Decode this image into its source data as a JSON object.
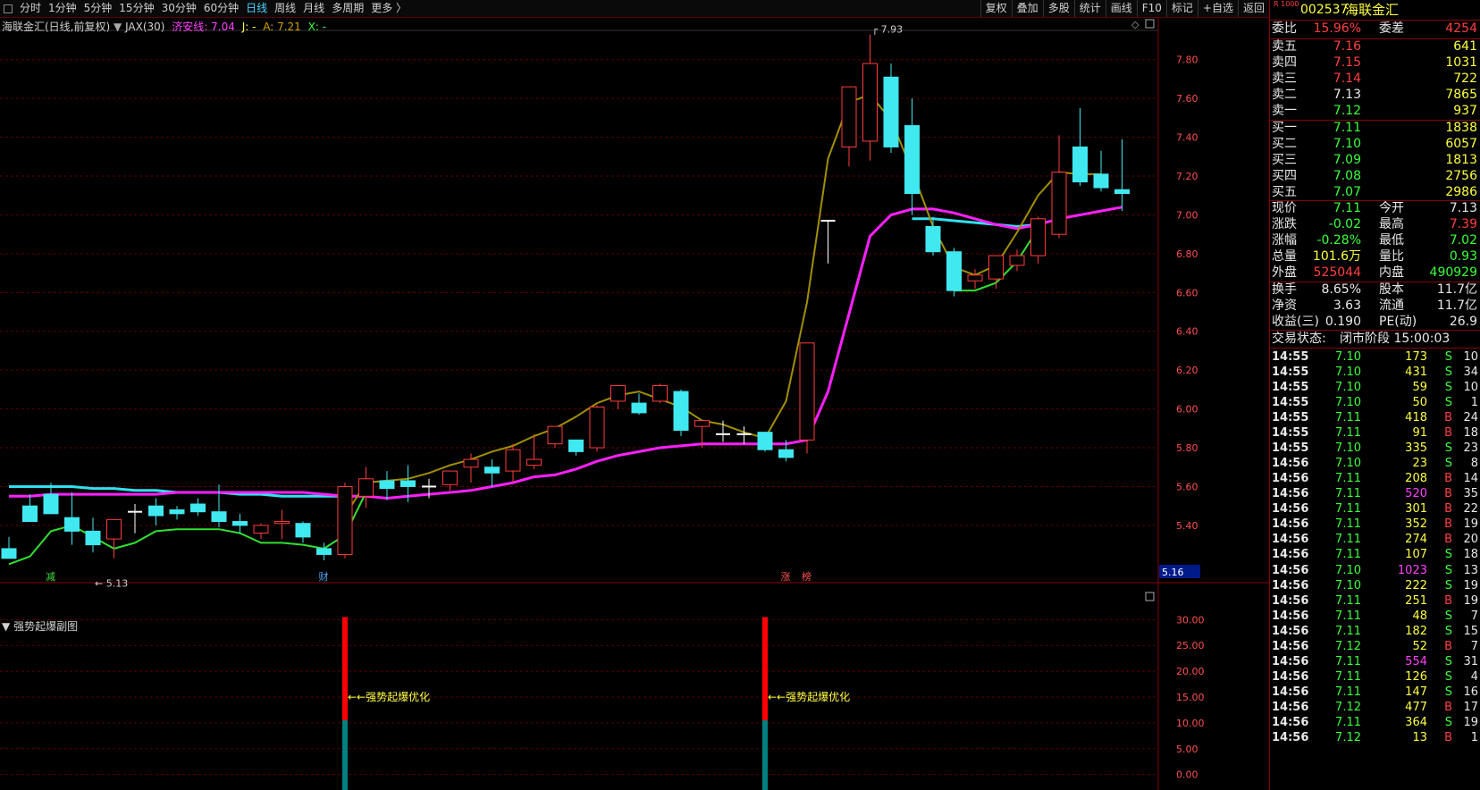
{
  "toolbar": {
    "periods": [
      "分时",
      "1分钟",
      "5分钟",
      "15分钟",
      "30分钟",
      "60分钟",
      "日线",
      "周线",
      "月线",
      "多周期",
      "更多 〉"
    ],
    "active": "日线",
    "right": [
      "复权",
      "叠加",
      "多股",
      "统计",
      "画线",
      "F10",
      "标记",
      "+自选",
      "返回"
    ]
  },
  "legend": {
    "title": "海联金汇(日线,前复权)",
    "indicator": "JAX(30)",
    "items": [
      {
        "text": "济安线: 7.04",
        "color": "#ff40ff"
      },
      {
        "text": "J: -",
        "color": "#ffff40"
      },
      {
        "text": "A: 7.21",
        "color": "#d0a000"
      },
      {
        "text": "X: -",
        "color": "#3cff3c"
      }
    ]
  },
  "chart_data": {
    "type": "candlestick",
    "y_ticks": [
      "7.80",
      "7.60",
      "7.40",
      "7.20",
      "7.00",
      "6.80",
      "6.60",
      "6.40",
      "6.20",
      "6.00",
      "5.80",
      "5.60",
      "5.40"
    ],
    "ylim": [
      5.16,
      7.96
    ],
    "current_price_tag": "5.16",
    "high_annotation": "7.93",
    "low_annotation": "5.13",
    "event_markers": [
      {
        "text": "减",
        "at": 2
      },
      {
        "text": "财",
        "at": 15
      },
      {
        "text": "涨",
        "at": 37
      },
      {
        "text": "榜",
        "at": 38
      }
    ],
    "candles": [
      {
        "o": 5.28,
        "h": 5.34,
        "l": 5.23,
        "c": 5.23
      },
      {
        "o": 5.5,
        "h": 5.56,
        "l": 5.44,
        "c": 5.42
      },
      {
        "o": 5.56,
        "h": 5.62,
        "l": 5.51,
        "c": 5.46
      },
      {
        "o": 5.44,
        "h": 5.57,
        "l": 5.3,
        "c": 5.37
      },
      {
        "o": 5.37,
        "h": 5.44,
        "l": 5.26,
        "c": 5.3
      },
      {
        "o": 5.33,
        "h": 5.42,
        "l": 5.23,
        "c": 5.43
      },
      {
        "o": 5.47,
        "h": 5.51,
        "l": 5.36,
        "c": 5.47
      },
      {
        "o": 5.5,
        "h": 5.54,
        "l": 5.4,
        "c": 5.45
      },
      {
        "o": 5.48,
        "h": 5.5,
        "l": 5.43,
        "c": 5.46
      },
      {
        "o": 5.51,
        "h": 5.54,
        "l": 5.45,
        "c": 5.47
      },
      {
        "o": 5.47,
        "h": 5.61,
        "l": 5.39,
        "c": 5.42
      },
      {
        "o": 5.42,
        "h": 5.46,
        "l": 5.36,
        "c": 5.4
      },
      {
        "o": 5.36,
        "h": 5.41,
        "l": 5.33,
        "c": 5.4
      },
      {
        "o": 5.41,
        "h": 5.48,
        "l": 5.33,
        "c": 5.42
      },
      {
        "o": 5.41,
        "h": 5.42,
        "l": 5.31,
        "c": 5.34
      },
      {
        "o": 5.28,
        "h": 5.31,
        "l": 5.22,
        "c": 5.25
      },
      {
        "o": 5.25,
        "h": 5.62,
        "l": 5.23,
        "c": 5.6
      },
      {
        "o": 5.55,
        "h": 5.7,
        "l": 5.49,
        "c": 5.64
      },
      {
        "o": 5.63,
        "h": 5.68,
        "l": 5.53,
        "c": 5.59
      },
      {
        "o": 5.63,
        "h": 5.71,
        "l": 5.52,
        "c": 5.6
      },
      {
        "o": 5.6,
        "h": 5.64,
        "l": 5.54,
        "c": 5.6
      },
      {
        "o": 5.61,
        "h": 5.68,
        "l": 5.58,
        "c": 5.68
      },
      {
        "o": 5.7,
        "h": 5.77,
        "l": 5.62,
        "c": 5.74
      },
      {
        "o": 5.7,
        "h": 5.74,
        "l": 5.6,
        "c": 5.67
      },
      {
        "o": 5.68,
        "h": 5.82,
        "l": 5.62,
        "c": 5.79
      },
      {
        "o": 5.71,
        "h": 5.87,
        "l": 5.69,
        "c": 5.74
      },
      {
        "o": 5.82,
        "h": 5.91,
        "l": 5.8,
        "c": 5.91
      },
      {
        "o": 5.84,
        "h": 5.81,
        "l": 5.76,
        "c": 5.78
      },
      {
        "o": 5.8,
        "h": 6.02,
        "l": 5.78,
        "c": 6.01
      },
      {
        "o": 6.04,
        "h": 6.12,
        "l": 6.0,
        "c": 6.12
      },
      {
        "o": 6.03,
        "h": 6.08,
        "l": 5.97,
        "c": 5.98
      },
      {
        "o": 6.04,
        "h": 6.13,
        "l": 6.03,
        "c": 6.12
      },
      {
        "o": 6.09,
        "h": 6.1,
        "l": 5.86,
        "c": 5.89
      },
      {
        "o": 5.91,
        "h": 5.94,
        "l": 5.8,
        "c": 5.94
      },
      {
        "o": 5.87,
        "h": 5.94,
        "l": 5.83,
        "c": 5.87
      },
      {
        "o": 5.87,
        "h": 5.91,
        "l": 5.82,
        "c": 5.87
      },
      {
        "o": 5.88,
        "h": 5.84,
        "l": 5.78,
        "c": 5.79
      },
      {
        "o": 5.79,
        "h": 5.84,
        "l": 5.73,
        "c": 5.75
      },
      {
        "o": 5.84,
        "h": 6.34,
        "l": 5.77,
        "c": 6.34
      },
      {
        "o": 6.97,
        "h": 6.97,
        "l": 6.75,
        "c": 6.97
      },
      {
        "o": 7.35,
        "h": 7.66,
        "l": 7.25,
        "c": 7.66
      },
      {
        "o": 7.38,
        "h": 7.93,
        "l": 7.28,
        "c": 7.78
      },
      {
        "o": 7.71,
        "h": 7.78,
        "l": 7.32,
        "c": 7.35
      },
      {
        "o": 7.46,
        "h": 7.6,
        "l": 7.0,
        "c": 7.11
      },
      {
        "o": 6.94,
        "h": 6.99,
        "l": 6.79,
        "c": 6.81
      },
      {
        "o": 6.81,
        "h": 6.83,
        "l": 6.58,
        "c": 6.61
      },
      {
        "o": 6.66,
        "h": 6.72,
        "l": 6.62,
        "c": 6.69
      },
      {
        "o": 6.67,
        "h": 6.79,
        "l": 6.62,
        "c": 6.79
      },
      {
        "o": 6.74,
        "h": 6.82,
        "l": 6.71,
        "c": 6.79
      },
      {
        "o": 6.79,
        "h": 6.99,
        "l": 6.75,
        "c": 6.98
      },
      {
        "o": 6.9,
        "h": 7.41,
        "l": 6.88,
        "c": 7.22
      },
      {
        "o": 7.35,
        "h": 7.55,
        "l": 7.15,
        "c": 7.17
      },
      {
        "o": 7.21,
        "h": 7.33,
        "l": 7.12,
        "c": 7.14
      },
      {
        "o": 7.13,
        "h": 7.39,
        "l": 7.02,
        "c": 7.11
      }
    ],
    "line_magenta": [
      5.55,
      5.55,
      5.56,
      5.56,
      5.56,
      5.56,
      5.56,
      5.56,
      5.57,
      5.57,
      5.57,
      5.57,
      5.57,
      5.57,
      5.57,
      5.56,
      5.55,
      5.55,
      5.54,
      5.55,
      5.56,
      5.57,
      5.58,
      5.6,
      5.62,
      5.65,
      5.66,
      5.69,
      5.73,
      5.76,
      5.78,
      5.8,
      5.81,
      5.82,
      5.82,
      5.82,
      5.82,
      5.82,
      5.84,
      6.09,
      6.49,
      6.89,
      7.0,
      7.03,
      7.03,
      7.01,
      6.98,
      6.95,
      6.93,
      6.95,
      6.98,
      7.0,
      7.02,
      7.04
    ],
    "line_cyan": [
      5.6,
      5.6,
      5.6,
      5.6,
      5.59,
      5.59,
      5.58,
      5.58,
      5.57,
      5.57,
      5.57,
      5.56,
      5.56,
      5.55,
      5.55,
      5.55,
      5.55,
      null,
      null,
      null,
      null,
      null,
      null,
      null,
      null,
      null,
      null,
      null,
      null,
      null,
      null,
      null,
      null,
      null,
      null,
      null,
      null,
      null,
      null,
      null,
      null,
      null,
      null,
      6.98,
      6.98,
      6.97,
      6.96,
      6.95,
      6.94,
      6.95,
      null,
      null,
      null,
      null
    ],
    "line_olive": [
      null,
      null,
      null,
      null,
      null,
      null,
      null,
      null,
      null,
      null,
      null,
      null,
      null,
      null,
      null,
      null,
      5.45,
      5.62,
      5.63,
      5.64,
      5.67,
      5.71,
      5.74,
      5.78,
      5.81,
      5.86,
      5.9,
      5.96,
      6.03,
      6.07,
      6.09,
      6.05,
      6.01,
      5.94,
      5.92,
      5.88,
      5.85,
      6.04,
      6.55,
      7.29,
      7.58,
      7.62,
      7.49,
      7.23,
      6.94,
      6.73,
      6.69,
      6.74,
      6.91,
      7.1,
      7.22,
      7.21,
      7.21
    ],
    "line_green": [
      5.2,
      5.24,
      5.37,
      5.4,
      5.34,
      5.28,
      5.31,
      5.37,
      5.38,
      5.38,
      5.38,
      5.36,
      5.31,
      5.31,
      5.3,
      5.28,
      5.35,
      5.57,
      null,
      null,
      null,
      null,
      null,
      null,
      null,
      null,
      null,
      null,
      null,
      null,
      null,
      null,
      null,
      null,
      null,
      null,
      null,
      null,
      null,
      null,
      null,
      null,
      null,
      null,
      null,
      6.61,
      6.61,
      6.65,
      6.76,
      6.93,
      null,
      null,
      null,
      null
    ],
    "sub_chart": {
      "title": "强势起爆副图",
      "y_ticks": [
        "30.00",
        "25.00",
        "20.00",
        "15.00",
        "10.00",
        "5.00",
        "0.00"
      ],
      "ylim": [
        -3,
        33
      ],
      "signals": [
        {
          "at": 16,
          "label": "←←强势起爆优化",
          "value": 30.5,
          "split": 10.5
        },
        {
          "at": 36,
          "label": "←←强势起爆优化",
          "value": 30.5,
          "split": 10.5
        }
      ]
    }
  },
  "panel": {
    "code_prefix": "R 1000",
    "code": "002537",
    "name": "海联金汇",
    "weibi_label": "委比",
    "weibi": "15.96%",
    "weicha_label": "委差",
    "weicha": "4254",
    "asks": [
      {
        "label": "卖五",
        "price": "7.16",
        "vol": "641",
        "pc": "red"
      },
      {
        "label": "卖四",
        "price": "7.15",
        "vol": "1031",
        "pc": "red"
      },
      {
        "label": "卖三",
        "price": "7.14",
        "vol": "722",
        "pc": "red"
      },
      {
        "label": "卖二",
        "price": "7.13",
        "vol": "7865",
        "pc": "wht"
      },
      {
        "label": "卖一",
        "price": "7.12",
        "vol": "937",
        "pc": "grn"
      }
    ],
    "bids": [
      {
        "label": "买一",
        "price": "7.11",
        "vol": "1838",
        "pc": "grn"
      },
      {
        "label": "买二",
        "price": "7.10",
        "vol": "6057",
        "pc": "grn"
      },
      {
        "label": "买三",
        "price": "7.09",
        "vol": "1813",
        "pc": "grn"
      },
      {
        "label": "买四",
        "price": "7.08",
        "vol": "2756",
        "pc": "grn"
      },
      {
        "label": "买五",
        "price": "7.07",
        "vol": "2986",
        "pc": "grn"
      }
    ],
    "quote": [
      {
        "l1": "现价",
        "v1": "7.11",
        "c1": "grn",
        "l2": "今开",
        "v2": "7.13",
        "c2": "wht"
      },
      {
        "l1": "涨跌",
        "v1": "-0.02",
        "c1": "grn",
        "l2": "最高",
        "v2": "7.39",
        "c2": "red"
      },
      {
        "l1": "涨幅",
        "v1": "-0.28%",
        "c1": "grn",
        "l2": "最低",
        "v2": "7.02",
        "c2": "grn"
      },
      {
        "l1": "总量",
        "v1": "101.6万",
        "c1": "yel",
        "l2": "量比",
        "v2": "0.93",
        "c2": "grn"
      },
      {
        "l1": "外盘",
        "v1": "525044",
        "c1": "red",
        "l2": "内盘",
        "v2": "490929",
        "c2": "grn"
      }
    ],
    "fundamentals": [
      {
        "l1": "换手",
        "v1": "8.65%",
        "l2": "股本",
        "v2": "11.7亿"
      },
      {
        "l1": "净资",
        "v1": "3.63",
        "l2": "流通",
        "v2": "11.7亿"
      },
      {
        "l1": "收益(三)",
        "v1": "0.190",
        "l2": "PE(动)",
        "v2": "26.9"
      }
    ],
    "status_label": "交易状态:",
    "status": "闭市阶段 15:00:03",
    "ticks": [
      {
        "t": "14:55",
        "p": "7.10",
        "v": "173",
        "s": "S",
        "n": "10"
      },
      {
        "t": "14:55",
        "p": "7.10",
        "v": "431",
        "s": "S",
        "n": "34"
      },
      {
        "t": "14:55",
        "p": "7.10",
        "v": "59",
        "s": "S",
        "n": "10"
      },
      {
        "t": "14:55",
        "p": "7.10",
        "v": "50",
        "s": "S",
        "n": "1"
      },
      {
        "t": "14:55",
        "p": "7.11",
        "v": "418",
        "s": "B",
        "n": "24"
      },
      {
        "t": "14:55",
        "p": "7.11",
        "v": "91",
        "s": "B",
        "n": "18"
      },
      {
        "t": "14:55",
        "p": "7.10",
        "v": "335",
        "s": "S",
        "n": "23"
      },
      {
        "t": "14:56",
        "p": "7.10",
        "v": "23",
        "s": "S",
        "n": "8"
      },
      {
        "t": "14:56",
        "p": "7.11",
        "v": "208",
        "s": "B",
        "n": "14"
      },
      {
        "t": "14:56",
        "p": "7.11",
        "v": "520",
        "s": "B",
        "n": "35"
      },
      {
        "t": "14:56",
        "p": "7.11",
        "v": "301",
        "s": "B",
        "n": "22"
      },
      {
        "t": "14:56",
        "p": "7.11",
        "v": "352",
        "s": "B",
        "n": "19"
      },
      {
        "t": "14:56",
        "p": "7.11",
        "v": "274",
        "s": "B",
        "n": "20"
      },
      {
        "t": "14:56",
        "p": "7.11",
        "v": "107",
        "s": "S",
        "n": "18"
      },
      {
        "t": "14:56",
        "p": "7.10",
        "v": "1023",
        "s": "S",
        "n": "13"
      },
      {
        "t": "14:56",
        "p": "7.10",
        "v": "222",
        "s": "S",
        "n": "19"
      },
      {
        "t": "14:56",
        "p": "7.11",
        "v": "251",
        "s": "B",
        "n": "19"
      },
      {
        "t": "14:56",
        "p": "7.11",
        "v": "48",
        "s": "S",
        "n": "7"
      },
      {
        "t": "14:56",
        "p": "7.11",
        "v": "182",
        "s": "S",
        "n": "15"
      },
      {
        "t": "14:56",
        "p": "7.12",
        "v": "52",
        "s": "B",
        "n": "7"
      },
      {
        "t": "14:56",
        "p": "7.11",
        "v": "554",
        "s": "S",
        "n": "31"
      },
      {
        "t": "14:56",
        "p": "7.11",
        "v": "126",
        "s": "S",
        "n": "4"
      },
      {
        "t": "14:56",
        "p": "7.11",
        "v": "147",
        "s": "S",
        "n": "16"
      },
      {
        "t": "14:56",
        "p": "7.12",
        "v": "477",
        "s": "B",
        "n": "17"
      },
      {
        "t": "14:56",
        "p": "7.11",
        "v": "364",
        "s": "S",
        "n": "19"
      },
      {
        "t": "14:56",
        "p": "7.12",
        "v": "13",
        "s": "B",
        "n": "1"
      }
    ]
  }
}
